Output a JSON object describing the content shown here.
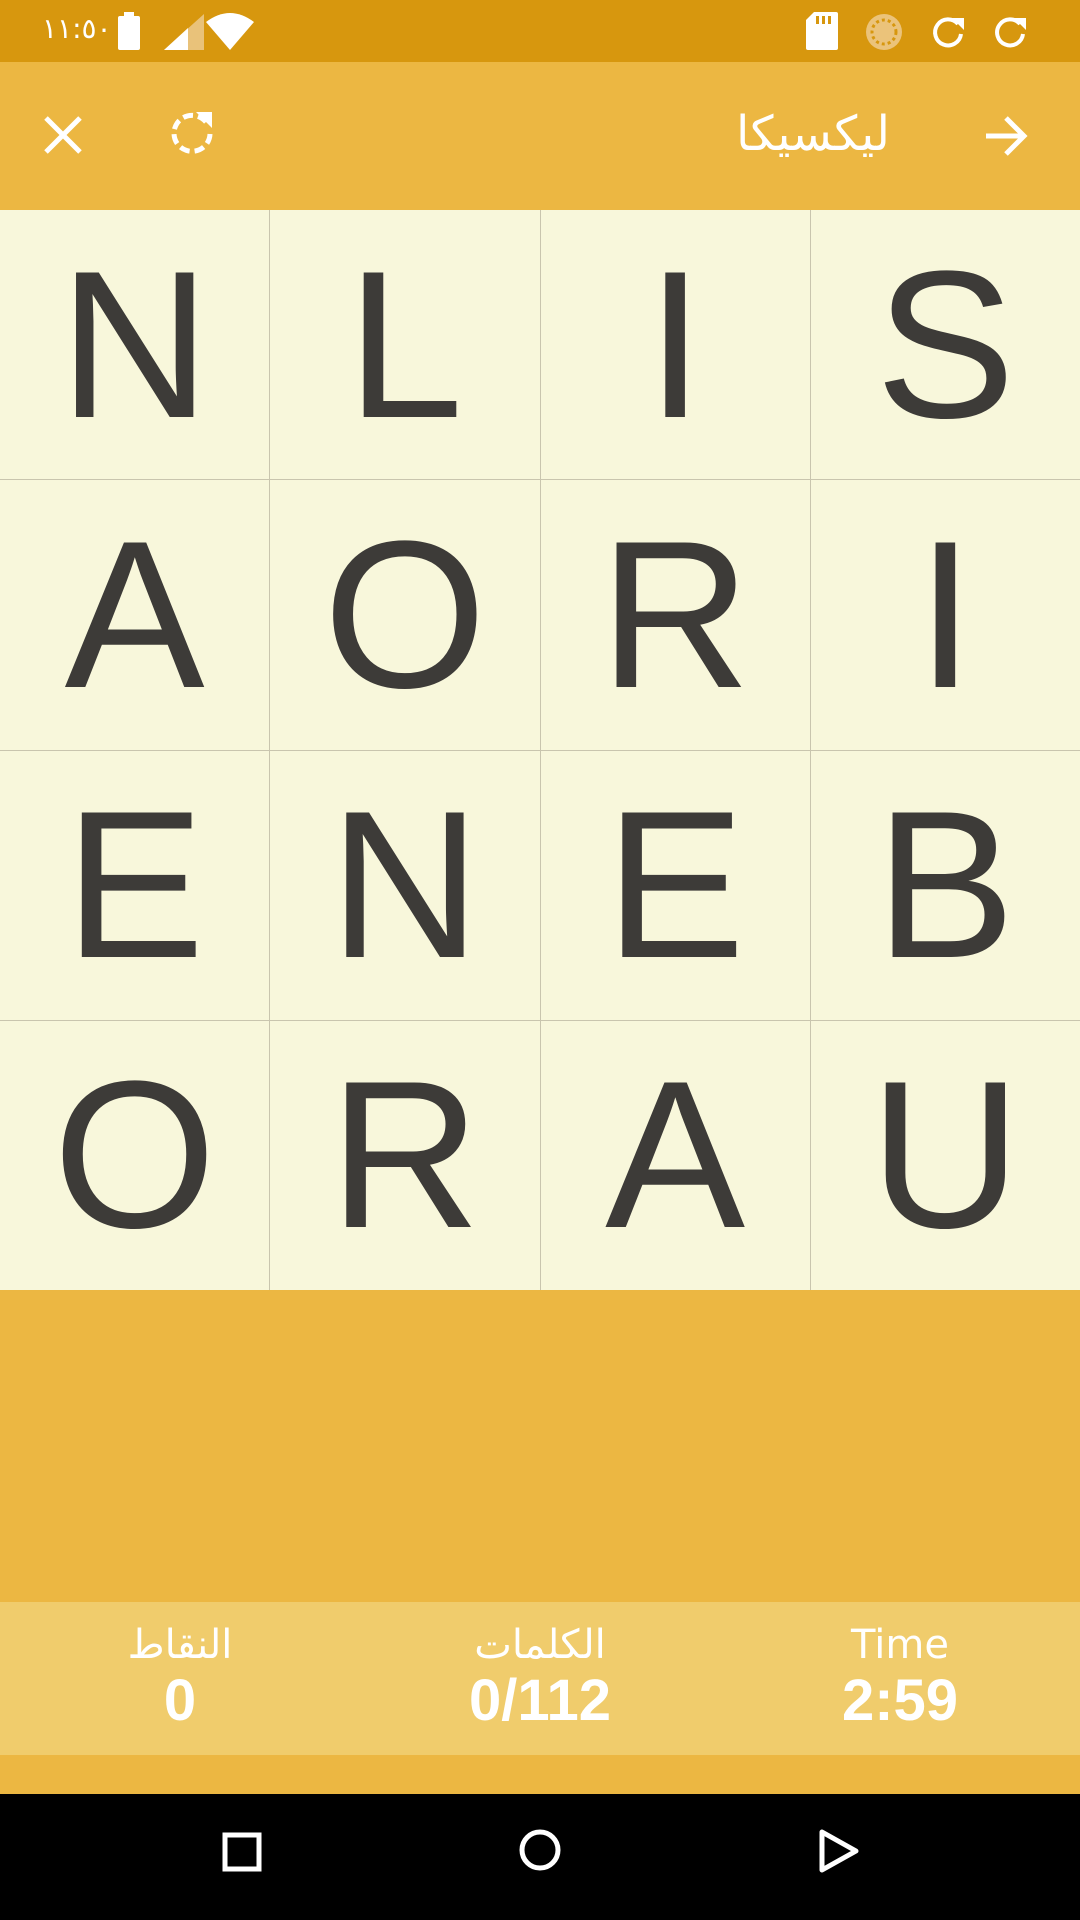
{
  "status_bar": {
    "time": "١١:٥٠",
    "icons": [
      "battery-icon",
      "signal-icon",
      "wifi-icon",
      "sd-card-icon",
      "sync-circle-icon",
      "refresh-icon",
      "refresh-icon"
    ]
  },
  "toolbar": {
    "title": "ليكسيكا",
    "close_icon": "close-icon",
    "restart_icon": "restart-icon",
    "forward_icon": "arrow-right-icon"
  },
  "board": {
    "letters": [
      [
        "N",
        "L",
        "I",
        "S"
      ],
      [
        "A",
        "O",
        "R",
        "I"
      ],
      [
        "E",
        "N",
        "E",
        "B"
      ],
      [
        "O",
        "R",
        "A",
        "U"
      ]
    ]
  },
  "stats": {
    "score_label": "النقاط",
    "score_value": "0",
    "words_label": "الكلمات",
    "words_value": "0/112",
    "time_label": "Time",
    "time_value": "2:59"
  },
  "colors": {
    "status_bar": "#D7970E",
    "accent": "#ECB742",
    "cell_bg": "#F8F7DB",
    "stats_bg": "#F0CC6C",
    "letter": "#3D3B38"
  },
  "nav_bar": {
    "buttons": [
      "recents-square-icon",
      "home-circle-icon",
      "back-triangle-icon"
    ]
  }
}
